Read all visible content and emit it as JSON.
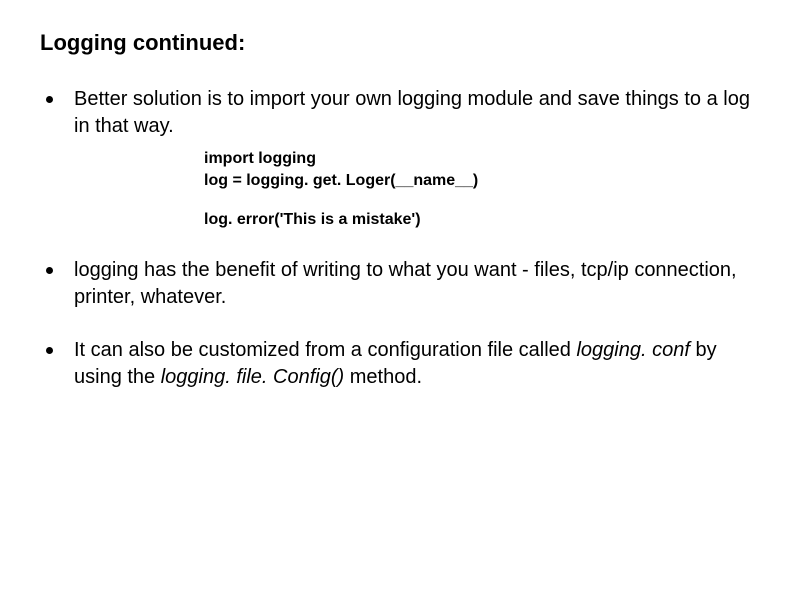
{
  "title": "Logging continued:",
  "bullet1": "Better solution is to import your own logging module and save things to a log in that way.",
  "code": {
    "line1": "import logging",
    "line2": "log = logging. get. Loger(__name__)",
    "line3": "log. error('This is a mistake')"
  },
  "bullet2": "logging has the benefit of writing to what you want - files, tcp/ip connection, printer, whatever.",
  "bullet3_part1": "It can also be customized from a configuration file called ",
  "bullet3_italic1": "logging. conf",
  "bullet3_part2": " by using the ",
  "bullet3_italic2": "logging. file. Config()",
  "bullet3_part3": " method."
}
